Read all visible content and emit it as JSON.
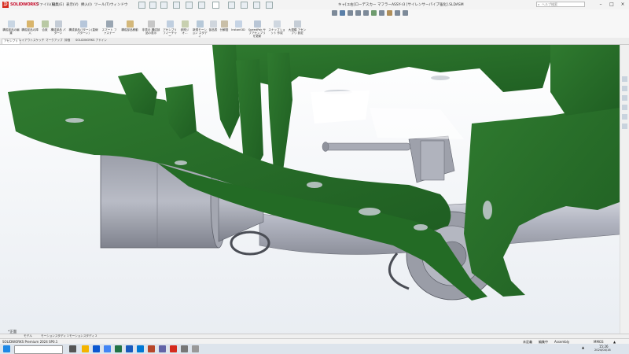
{
  "app": {
    "logo_text": "SOLIDWORKS",
    "menus": [
      "ファイル(F)",
      "編集(E)",
      "表示(V)",
      "挿入(I)",
      "ツール(T)",
      "ウィンドウ"
    ],
    "document_title": "キャ[ユ右]ローデスカー マフラーASSY-r3 [サイレンサーパイプ強化].SLDASM",
    "search_placeholder": "ヘルプ検索"
  },
  "ribbon": {
    "buttons": [
      "構成部品の編集",
      "構成部品の挿入",
      "合致",
      "構成部品 パターン",
      "構成部品パターン(直線パターン)",
      "スマート ファスナー",
      "構成部品移動",
      "非表示 構成部品の表示",
      "アセンブリ フィーチャー",
      "参照ジオ…",
      "新規モーション スタディ",
      "部品表",
      "分解図",
      "Instant3D",
      "SpeedPak サブアセンブリ を更新",
      "スナップショット 作成",
      "大規模 アセンブリ 設定"
    ]
  },
  "command_tabs": [
    "アセンブリ",
    "レイアウト",
    "スケッチ",
    "マークアップ",
    "評価",
    "SOLIDWORKS アドイン"
  ],
  "bottom_tabs": [
    "モデル",
    "モーションスタディ 1",
    "モーションスタディ 2"
  ],
  "axis_label": "*正面",
  "status": {
    "left": "SOLIDWORKS Premium 2024 SP0.1",
    "mid1": "未定義",
    "mid2": "編集中",
    "mid3": "Assembly",
    "units": "MMGS",
    "arrow": "▲"
  },
  "taskbar": {
    "time": "15:26",
    "date": "2024/04/16"
  }
}
